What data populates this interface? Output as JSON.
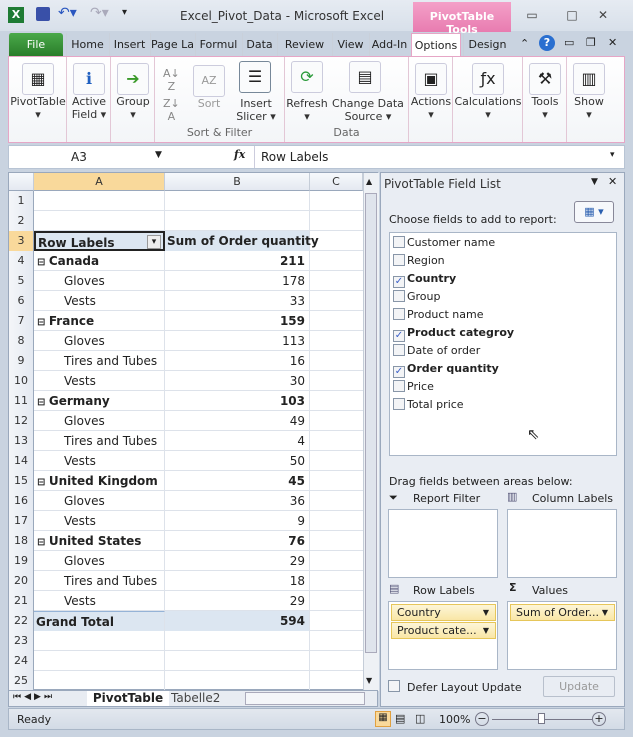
{
  "window": {
    "title": "Excel_Pivot_Data  -  Microsoft Excel",
    "context_tab": "PivotTable Tools"
  },
  "tabs": [
    "File",
    "Home",
    "Insert",
    "Page La",
    "Formul",
    "Data",
    "Review",
    "View",
    "Add-In",
    "Options",
    "Design"
  ],
  "ribbon": {
    "pivottable": "PivotTable",
    "active_field_1": "Active",
    "active_field_2": "Field",
    "group": "Group",
    "sort": "Sort",
    "insert_slicer_1": "Insert",
    "insert_slicer_2": "Slicer",
    "sort_filter_group": "Sort & Filter",
    "refresh": "Refresh",
    "change_source_1": "Change Data",
    "change_source_2": "Source",
    "data_group": "Data",
    "actions": "Actions",
    "calculations": "Calculations",
    "tools": "Tools",
    "show": "Show"
  },
  "formula_bar": {
    "name_box": "A3",
    "fx": "fx",
    "content": "Row Labels"
  },
  "columns": [
    "A",
    "B",
    "C"
  ],
  "rows": [
    {
      "n": "1",
      "a": "",
      "b": "",
      "type": "empty"
    },
    {
      "n": "2",
      "a": "",
      "b": "",
      "type": "empty"
    },
    {
      "n": "3",
      "a": "Row Labels",
      "b": "Sum of Order quantity",
      "type": "header"
    },
    {
      "n": "4",
      "a": "Canada",
      "b": "211",
      "type": "group"
    },
    {
      "n": "5",
      "a": "Gloves",
      "b": "178",
      "type": "item"
    },
    {
      "n": "6",
      "a": "Vests",
      "b": "33",
      "type": "item"
    },
    {
      "n": "7",
      "a": "France",
      "b": "159",
      "type": "group"
    },
    {
      "n": "8",
      "a": "Gloves",
      "b": "113",
      "type": "item"
    },
    {
      "n": "9",
      "a": "Tires and Tubes",
      "b": "16",
      "type": "item"
    },
    {
      "n": "10",
      "a": "Vests",
      "b": "30",
      "type": "item"
    },
    {
      "n": "11",
      "a": "Germany",
      "b": "103",
      "type": "group"
    },
    {
      "n": "12",
      "a": "Gloves",
      "b": "49",
      "type": "item"
    },
    {
      "n": "13",
      "a": "Tires and Tubes",
      "b": "4",
      "type": "item"
    },
    {
      "n": "14",
      "a": "Vests",
      "b": "50",
      "type": "item"
    },
    {
      "n": "15",
      "a": "United Kingdom",
      "b": "45",
      "type": "group"
    },
    {
      "n": "16",
      "a": "Gloves",
      "b": "36",
      "type": "item"
    },
    {
      "n": "17",
      "a": "Vests",
      "b": "9",
      "type": "item"
    },
    {
      "n": "18",
      "a": "United States",
      "b": "76",
      "type": "group"
    },
    {
      "n": "19",
      "a": "Gloves",
      "b": "29",
      "type": "item"
    },
    {
      "n": "20",
      "a": "Tires and Tubes",
      "b": "18",
      "type": "item"
    },
    {
      "n": "21",
      "a": "Vests",
      "b": "29",
      "type": "item"
    },
    {
      "n": "22",
      "a": "Grand Total",
      "b": "594",
      "type": "total"
    },
    {
      "n": "23",
      "a": "",
      "b": "",
      "type": "empty"
    },
    {
      "n": "24",
      "a": "",
      "b": "",
      "type": "empty"
    },
    {
      "n": "25",
      "a": "",
      "b": "",
      "type": "empty"
    }
  ],
  "sheet_tabs": [
    "PivotTable",
    "Tabelle2"
  ],
  "status": {
    "ready": "Ready",
    "zoom": "100%",
    "zoom_fraction": 0.5
  },
  "field_list": {
    "title": "PivotTable Field List",
    "choose": "Choose fields to add to report:",
    "fields": [
      {
        "name": "Customer name",
        "checked": false
      },
      {
        "name": "Region",
        "checked": false
      },
      {
        "name": "Country",
        "checked": true
      },
      {
        "name": "Group",
        "checked": false
      },
      {
        "name": "Product name",
        "checked": false
      },
      {
        "name": "Product categroy",
        "checked": true
      },
      {
        "name": "Date of order",
        "checked": false
      },
      {
        "name": "Order quantity",
        "checked": true
      },
      {
        "name": "Price",
        "checked": false
      },
      {
        "name": "Total price",
        "checked": false
      }
    ],
    "drag": "Drag fields between areas below:",
    "report_filter": "Report Filter",
    "column_labels": "Column Labels",
    "row_labels": "Row Labels",
    "values": "Values",
    "row_items": [
      "Country",
      "Product cate..."
    ],
    "value_items": [
      "Sum of Order..."
    ],
    "defer": "Defer Layout Update",
    "update": "Update"
  }
}
